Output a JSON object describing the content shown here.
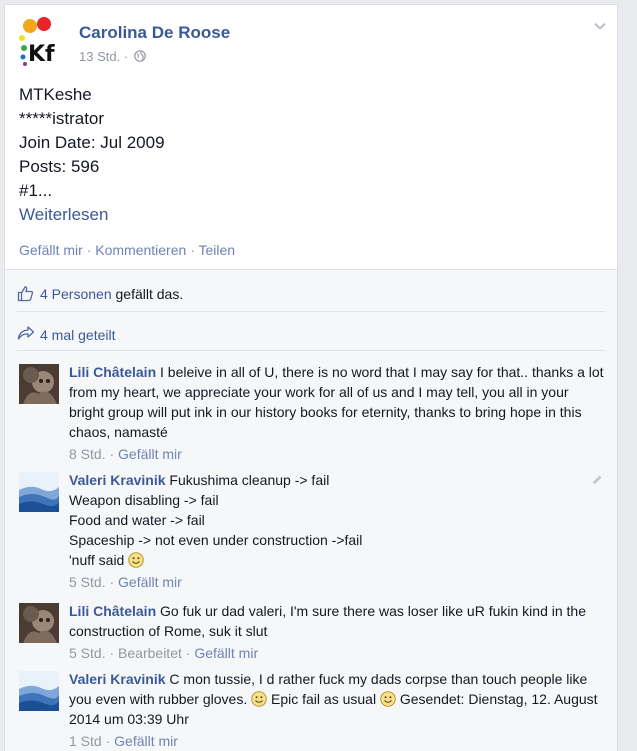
{
  "post": {
    "author": "Carolina De Roose",
    "time": "13 Std. ·",
    "privacy_icon": "globe-icon",
    "logo_letters": "Kf",
    "body": {
      "line1": "MTKeshe",
      "line2": "*****istrator",
      "line3": "Join Date: Jul 2009",
      "line4": "Posts: 596",
      "line5": "#1...",
      "read_more": "Weiterlesen"
    },
    "actions": {
      "like": "Gefällt mir",
      "comment": "Kommentieren",
      "share": "Teilen",
      "sep": "·"
    }
  },
  "social": {
    "likes_link": "4 Personen",
    "likes_text": "gefällt das.",
    "shares_text": "4 mal geteilt"
  },
  "comments": [
    {
      "name": "Lili Châtelain",
      "text": "I beleive in all of U, there is no word that I may say for that.. thanks a lot from my heart, we appreciate your work for all of us and I may tell, you all in your bright group will put ink in our history books for eternity, thanks to bring hope in this chaos, namasté",
      "time": "8 Std.",
      "like": "Gefällt mir"
    },
    {
      "name": "Valeri Kravinik",
      "line1": "Fukushima cleanup -> fail",
      "line2": "Weapon disabling -> fail",
      "line3": "Food and water -> fail",
      "line4": "Spaceship -> not even under construction ->fail",
      "line5": "'nuff said",
      "time": "5 Std.",
      "like": "Gefällt mir"
    },
    {
      "name": "Lili Châtelain",
      "text": "Go fuk ur dad valeri, I'm sure there was loser like uR fukin kind in the construction of Rome, suk it slut",
      "time": "5 Std.",
      "edited": "Bearbeitet",
      "like": "Gefällt mir"
    },
    {
      "name": "Valeri Kravinik",
      "text_a": "C mon tussie, I d rather fuck my dads corpse than touch people like you even with rubber gloves.",
      "text_b": "Epic fail as usual",
      "text_c": "Gesendet: Dienstag, 12. August 2014 um 03:39 Uhr",
      "time": "1 Std",
      "like": "Gefällt mir"
    }
  ],
  "colors": {
    "link": "#3b5998",
    "meta": "#9197a3",
    "social_bg": "#f6f7f9"
  }
}
